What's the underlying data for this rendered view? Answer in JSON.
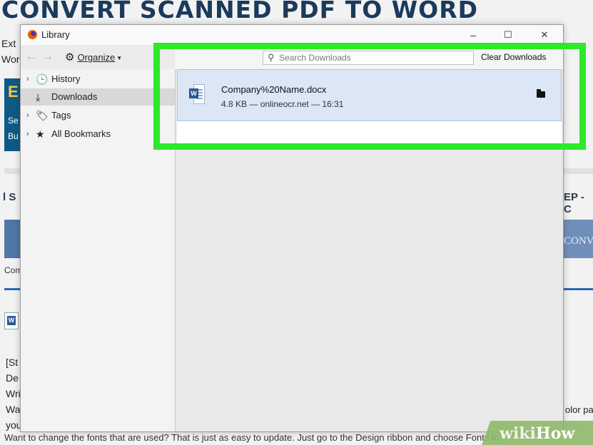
{
  "background_page": {
    "title": "CONVERT SCANNED PDF TO WORD",
    "left_fragments": [
      "Ext",
      "Wor"
    ],
    "blue_box": {
      "big_letter": "E",
      "lines": [
        "Se",
        "Bu"
      ]
    },
    "section_left": "l S",
    "section_right": "EP - C",
    "band_right_text": "CONV",
    "comp_fragment": "Comp",
    "word_icon_letter": "W",
    "paragraph_fragments": [
      "[St",
      "De",
      "Wri",
      "Wa",
      "you"
    ],
    "right_fragment": "olor pa",
    "bottom_line": "Want to change the fonts that are used? That is just as easy to update. Just go to the Design ribbon and choose Fonts to"
  },
  "watermark": {
    "wiki": "wiki",
    "how": "How"
  },
  "window": {
    "title": "Library",
    "controls": {
      "minimize": "–",
      "maximize": "☐",
      "close": "✕"
    },
    "nav": {
      "back": "←",
      "forward": "→"
    },
    "organize_label": "Organize",
    "sidebar": [
      {
        "label": "History",
        "icon": "clock-icon",
        "glyph": "🕒",
        "twisty": "›",
        "selected": false
      },
      {
        "label": "Downloads",
        "icon": "download-icon",
        "glyph": "⤓",
        "twisty": "",
        "selected": true
      },
      {
        "label": "Tags",
        "icon": "tag-icon",
        "glyph": "🏷",
        "twisty": "›",
        "selected": false
      },
      {
        "label": "All Bookmarks",
        "icon": "star-icon",
        "glyph": "★",
        "twisty": "›",
        "selected": false
      }
    ],
    "search": {
      "placeholder": "Search Downloads",
      "value": ""
    },
    "clear_label": "Clear Downloads",
    "downloads": [
      {
        "name": "Company%20Name.docx",
        "meta": "4.8 KB — onlineocr.net — 16:31"
      }
    ]
  },
  "colors": {
    "highlight": "#2ee82a",
    "selected_row": "#dbe7f4"
  }
}
